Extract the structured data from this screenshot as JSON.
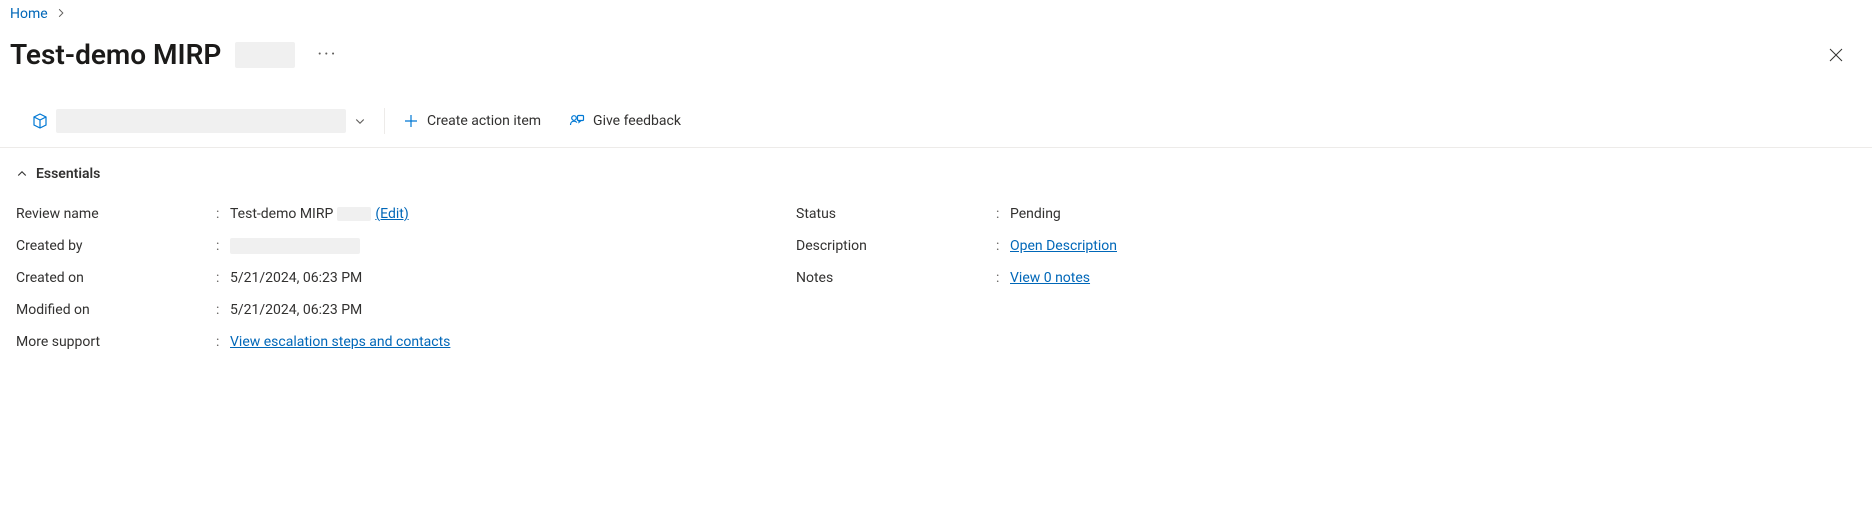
{
  "breadcrumb": {
    "home": "Home"
  },
  "header": {
    "title": "Test-demo MIRP"
  },
  "commands": {
    "create_action_item": "Create action item",
    "give_feedback": "Give feedback"
  },
  "essentials": {
    "section_label": "Essentials",
    "left": [
      {
        "label": "Review name",
        "value": "Test-demo MIRP",
        "edit_link": "(Edit)"
      },
      {
        "label": "Created by",
        "value": ""
      },
      {
        "label": "Created on",
        "value": "5/21/2024, 06:23 PM"
      },
      {
        "label": "Modified on",
        "value": "5/21/2024, 06:23 PM"
      },
      {
        "label": "More support",
        "link": "View escalation steps and contacts"
      }
    ],
    "right": [
      {
        "label": "Status",
        "value": "Pending"
      },
      {
        "label": "Description",
        "link": "Open Description"
      },
      {
        "label": "Notes",
        "link": "View 0 notes"
      }
    ]
  }
}
